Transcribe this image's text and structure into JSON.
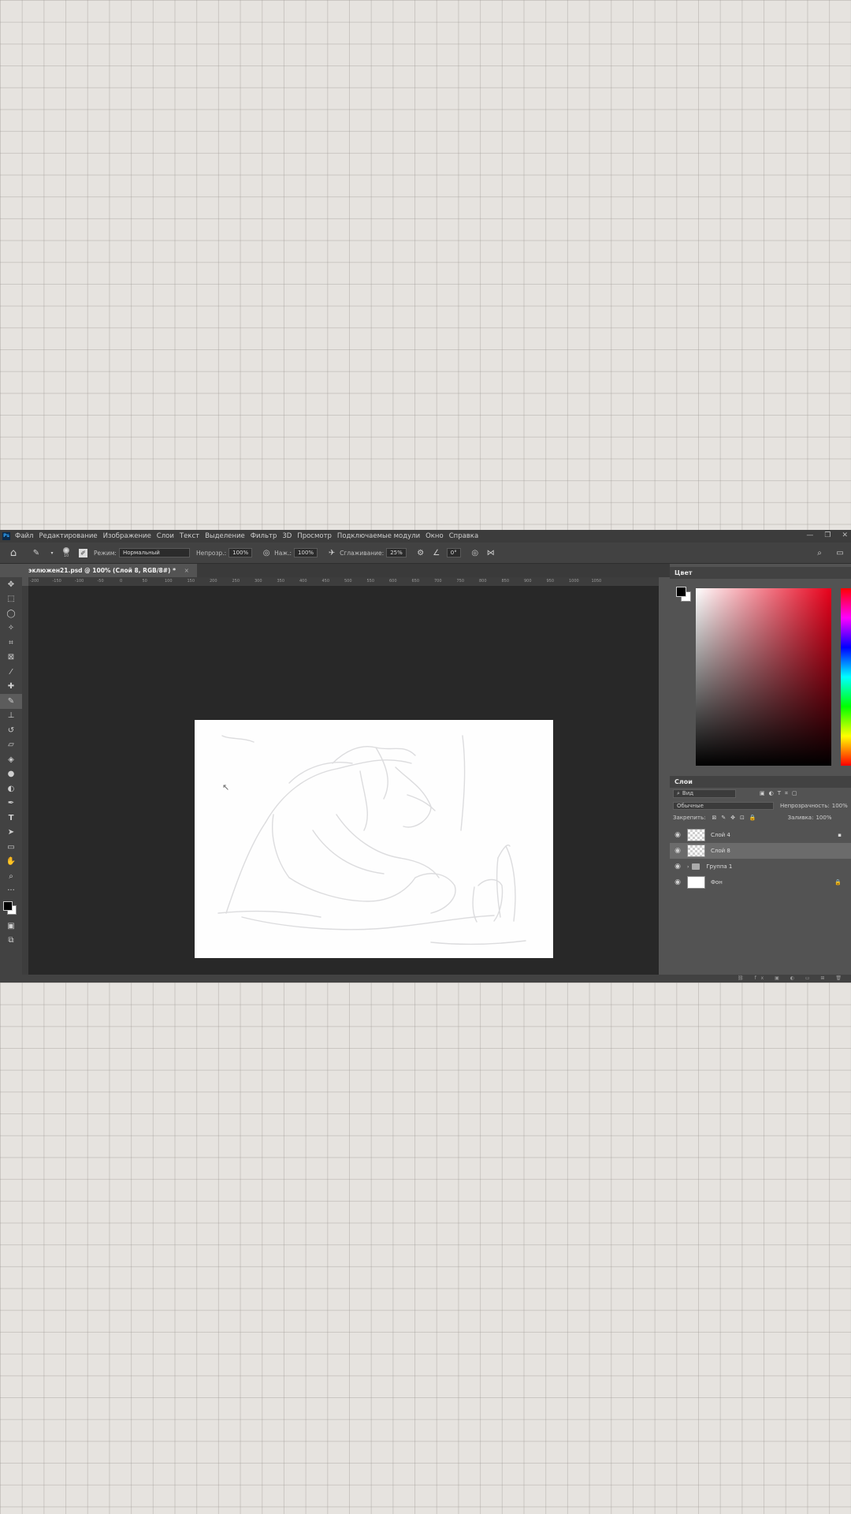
{
  "app": {
    "logo": "Ps"
  },
  "menu": [
    "Файл",
    "Редактирование",
    "Изображение",
    "Слои",
    "Текст",
    "Выделение",
    "Фильтр",
    "3D",
    "Просмотр",
    "Подключаемые модули",
    "Окно",
    "Справка"
  ],
  "options": {
    "brush_size": "10",
    "mode_label": "Режим:",
    "mode_value": "Нормальный",
    "opacity_label": "Непрозр.:",
    "opacity_value": "100%",
    "flow_label": "Наж.:",
    "flow_value": "100%",
    "smoothing_label": "Сглаживание:",
    "smoothing_value": "25%",
    "angle_value": "0°"
  },
  "document": {
    "tab_title": "эклюжен21.psd @ 100% (Слой 8, RGB/8#) *",
    "close": "×"
  },
  "ruler_ticks": [
    "-200",
    "-150",
    "-100",
    "-50",
    "0",
    "50",
    "100",
    "150",
    "200",
    "250",
    "300",
    "350",
    "400",
    "450",
    "500",
    "550",
    "600",
    "650",
    "700",
    "750",
    "800",
    "850",
    "900",
    "950",
    "1000",
    "1050"
  ],
  "tools": [
    "move-icon",
    "marquee-icon",
    "lasso-icon",
    "magic-wand-icon",
    "crop-icon",
    "frame-icon",
    "eyedropper-icon",
    "healing-icon",
    "brush-icon",
    "stamp-icon",
    "history-brush-icon",
    "eraser-icon",
    "bucket-icon",
    "blur-icon",
    "dodge-icon",
    "pen-icon",
    "type-icon",
    "path-select-icon",
    "rectangle-icon",
    "hand-icon",
    "zoom-icon",
    "more-icon"
  ],
  "color_panel": {
    "title": "Цвет",
    "foreground": "#000000",
    "background": "#ffffff"
  },
  "layers_panel": {
    "title": "Слои",
    "filter_label": "Вид",
    "blend_mode": "Обычные",
    "opacity_label": "Непрозрачность:",
    "opacity_value": "100%",
    "lock_label": "Закрепить:",
    "fill_label": "Заливка:",
    "fill_value": "100%",
    "layers": [
      {
        "name": "Слой 4",
        "selected": false,
        "type": "pixel"
      },
      {
        "name": "Слой 8",
        "selected": true,
        "type": "pixel"
      },
      {
        "name": "Группа 1",
        "selected": false,
        "type": "group"
      },
      {
        "name": "Фон",
        "selected": false,
        "type": "background"
      }
    ]
  }
}
